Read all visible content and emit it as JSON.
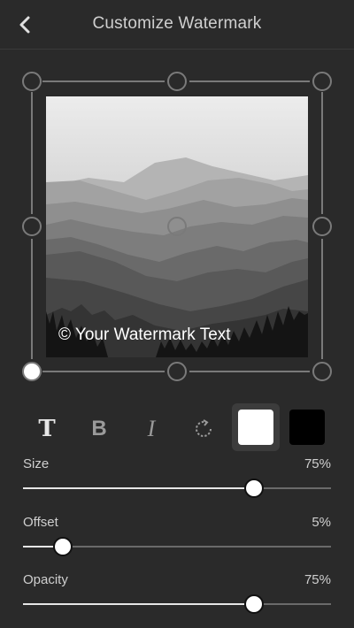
{
  "header": {
    "title": "Customize Watermark",
    "back_icon": "chevron-left-icon"
  },
  "preview": {
    "watermark_text": "© Your Watermark Text"
  },
  "toolbar": {
    "text_glyph": "T",
    "bold_glyph": "B",
    "italic_glyph": "I",
    "rotate_icon": "rotate-icon",
    "colors": {
      "white": "#ffffff",
      "black": "#000000"
    },
    "selected_color": "white"
  },
  "sliders": {
    "size": {
      "label": "Size",
      "value_text": "75%",
      "value": 0.75
    },
    "offset": {
      "label": "Offset",
      "value_text": "5%",
      "value": 0.13
    },
    "opacity": {
      "label": "Opacity",
      "value_text": "75%",
      "value": 0.75
    }
  },
  "colors": {
    "background": "#2a2a2a",
    "handle": "#777777",
    "active_handle": "#ffffff"
  }
}
